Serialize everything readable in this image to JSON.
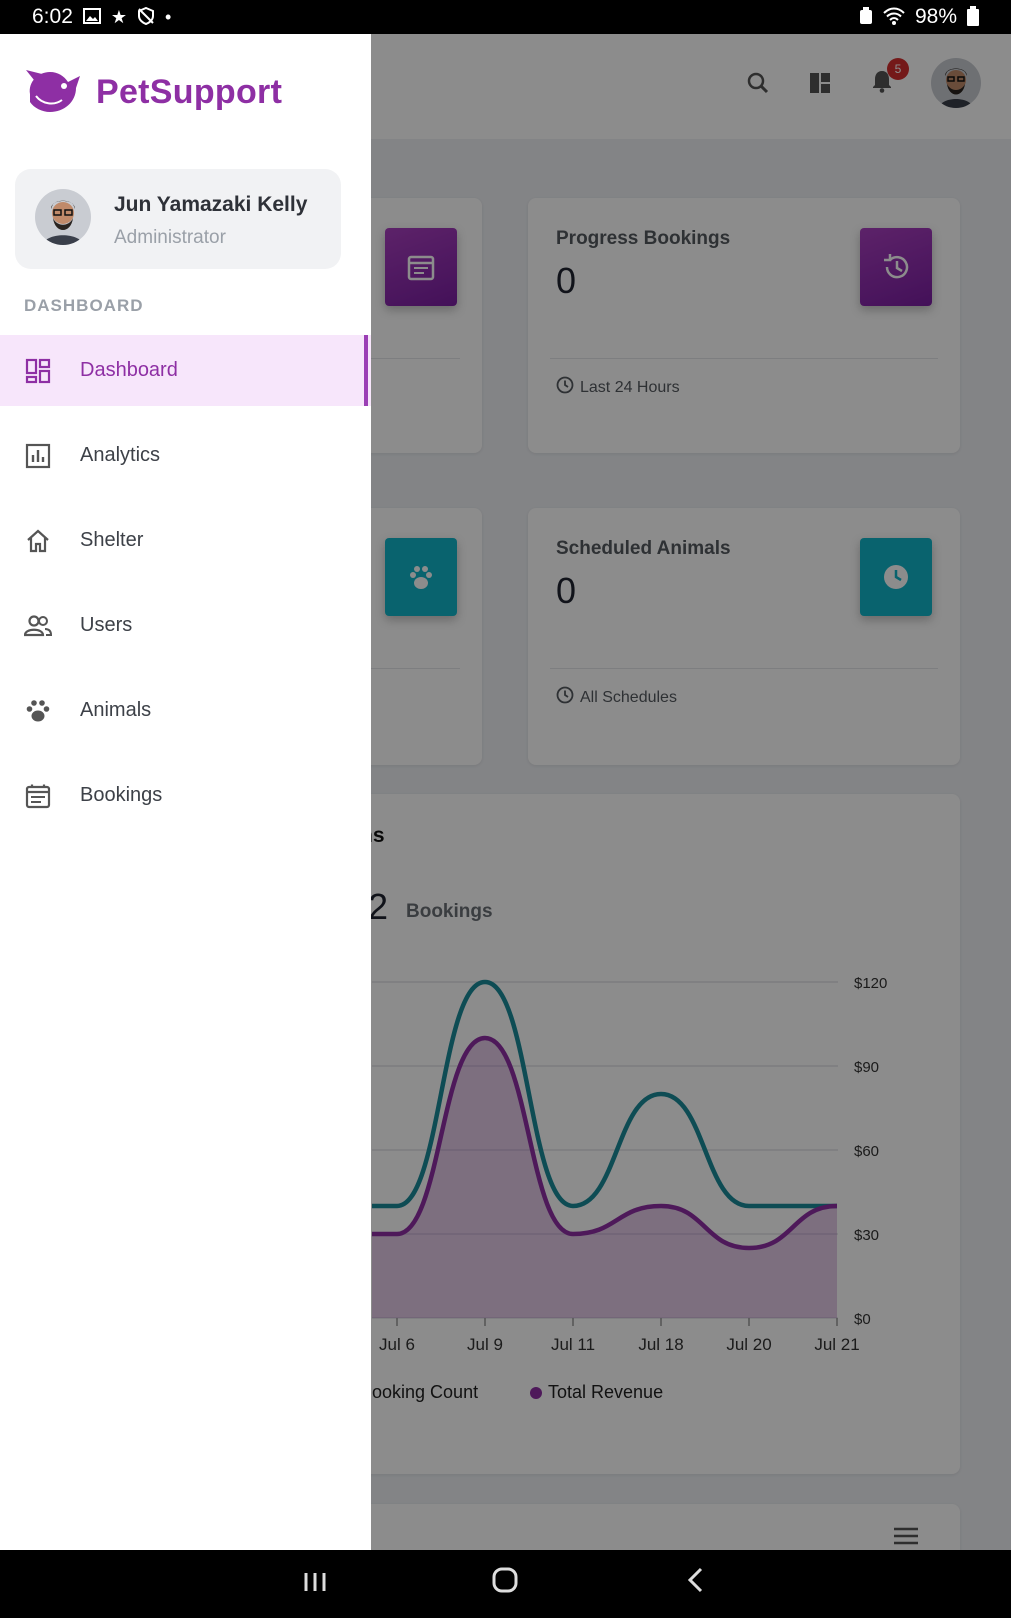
{
  "status_bar": {
    "time": "6:02",
    "battery": "98%",
    "icons_left": [
      "image-icon",
      "star-icon",
      "shield-off-icon",
      "dot-icon"
    ],
    "icons_right": [
      "battery-saver-icon",
      "wifi-icon",
      "battery-icon"
    ]
  },
  "topbar": {
    "notification_count": "5"
  },
  "stats": [
    {
      "title": "Progress Bookings",
      "value": "0",
      "footer": "Last 24 Hours",
      "color": "#9c27b0"
    },
    {
      "title": "Scheduled Animals",
      "value": "0",
      "footer": "All Schedules",
      "color": "#00acc1"
    }
  ],
  "chart": {
    "heading_fragment": "hs",
    "total_fragment": "2",
    "total_label": "Bookings",
    "legend": [
      {
        "label": "Booking Count",
        "color": "#1b8a99"
      },
      {
        "label": "Total Revenue",
        "color": "#8e2fa4"
      }
    ]
  },
  "chart_data": {
    "type": "line",
    "x": [
      "Jul 6",
      "Jul 9",
      "Jul 11",
      "Jul 18",
      "Jul 20",
      "Jul 21"
    ],
    "y_right_ticks": [
      "$120",
      "$90",
      "$60",
      "$30",
      "$0"
    ],
    "ylim_right": [
      0,
      120
    ],
    "series": [
      {
        "name": "Booking Count",
        "color": "#1b8a99",
        "values": [
          40,
          120,
          40,
          80,
          40,
          40
        ]
      },
      {
        "name": "Total Revenue",
        "color": "#8e2fa4",
        "area": true,
        "values": [
          30,
          100,
          30,
          40,
          25,
          40
        ]
      }
    ]
  },
  "drawer": {
    "brand": "PetSupport",
    "brand_color": "#8e2fa4",
    "user": {
      "name": "Jun Yamazaki Kelly",
      "role": "Administrator"
    },
    "section": "DASHBOARD",
    "items": [
      {
        "label": "Dashboard",
        "icon": "dashboard-icon",
        "active": true
      },
      {
        "label": "Analytics",
        "icon": "analytics-icon"
      },
      {
        "label": "Shelter",
        "icon": "home-icon"
      },
      {
        "label": "Users",
        "icon": "users-icon"
      },
      {
        "label": "Animals",
        "icon": "paw-icon"
      },
      {
        "label": "Bookings",
        "icon": "calendar-icon"
      }
    ]
  }
}
